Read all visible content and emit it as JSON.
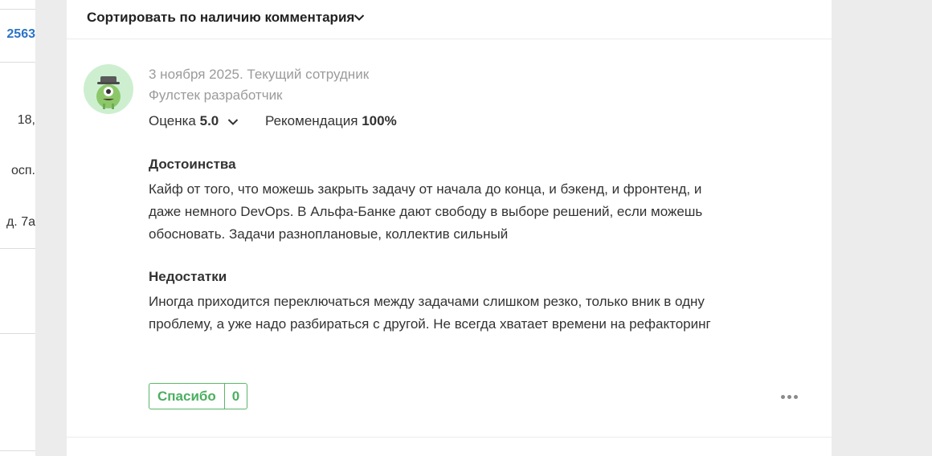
{
  "left": {
    "items": [
      "2563",
      "18,",
      "осп.",
      "д. 7а"
    ]
  },
  "sort": {
    "label": "Сортировать по наличию комментария",
    "chevron_icon": "chevron-down-icon"
  },
  "review": {
    "avatar_icon": "green-monster-avatar",
    "date_status": "3 ноября 2025. Текущий сотрудник",
    "position": "Фулстек разработчик",
    "rating_label": "Оценка",
    "rating_value": "5.0",
    "recommend_label": "Рекомендация",
    "recommend_value": "100%",
    "pros_title": "Достоинства",
    "pros_text": "Кайф от того, что можешь закрыть задачу от начала до конца, и бэкенд, и фронтенд, и даже немного DevOps. В Альфа-Банке дают свободу в выборе решений, если можешь обосновать. Задачи разноплановые, коллектив сильный",
    "cons_title": "Недостатки",
    "cons_text": "Иногда приходится переключаться между задачами слишком резко, только вник в одну проблему, а уже надо разбираться с другой. Не всегда хватает времени на рефакторинг",
    "thanks_label": "Спасибо",
    "thanks_count": "0",
    "more_icon": "more-dots-icon"
  },
  "colors": {
    "accent_green": "#4caf5f",
    "link_blue": "#2a73c5",
    "avatar_bg": "#cdefd0"
  }
}
